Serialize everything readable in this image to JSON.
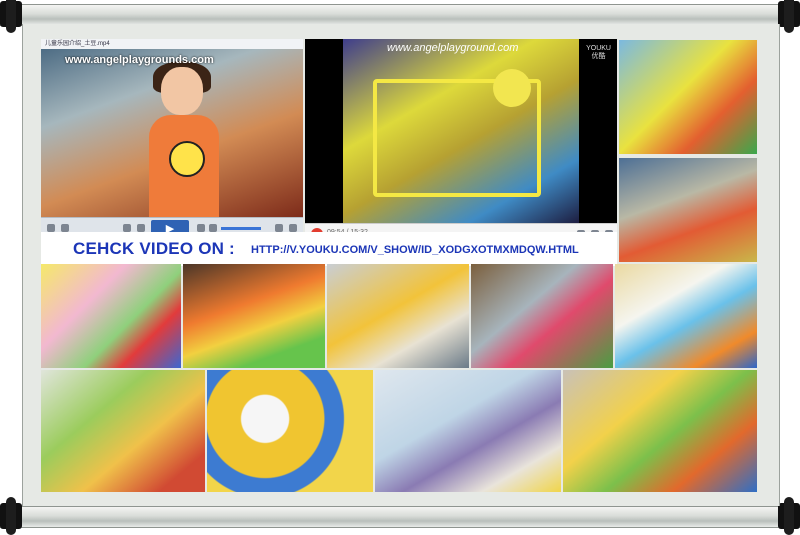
{
  "player1": {
    "title_text": "儿童乐园介绍_土豆.mp4",
    "watermark": "www.angelplaygrounds.com",
    "play_symbol": "▶"
  },
  "player2": {
    "watermark": "www.angelplayground.com",
    "logo_line1": "YOUKU",
    "logo_line2": "优酷",
    "time": "09:54 / 15:32"
  },
  "banner": {
    "label": "CEHCK VIDEO ON :",
    "url": "HTTP://V.YOUKU.COM/V_SHOW/ID_XODGXOTMXMDQW.HTML"
  },
  "icons": {
    "play": "play-icon",
    "volume": "volume-icon",
    "fullscreen": "fullscreen-icon"
  },
  "colors": {
    "banner_text": "#1c36b7",
    "player_play": "#2f62b4",
    "youku_play": "#e23c2f"
  }
}
